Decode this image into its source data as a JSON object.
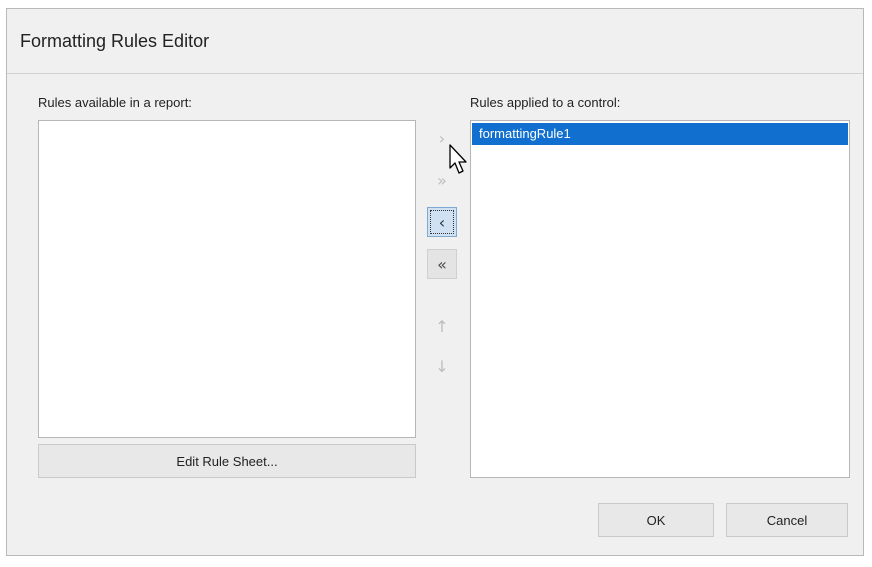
{
  "dialog": {
    "title": "Formatting Rules Editor"
  },
  "available": {
    "label": "Rules available in a report:",
    "items": [],
    "edit_button": "Edit Rule Sheet..."
  },
  "applied": {
    "label": "Rules applied to a control:",
    "items": [
      "formattingRule1"
    ],
    "selected_index": 0
  },
  "transfer_buttons": {
    "move_right": {
      "glyph": "›",
      "icon": "chevron-right-icon",
      "enabled": false
    },
    "move_all_right": {
      "glyph": "»",
      "icon": "double-chevron-right-icon",
      "enabled": false
    },
    "move_left": {
      "glyph": "‹",
      "icon": "chevron-left-icon",
      "enabled": true,
      "focused": true
    },
    "move_all_left": {
      "glyph": "«",
      "icon": "double-chevron-left-icon",
      "enabled": true
    },
    "move_up": {
      "glyph": "↑",
      "icon": "arrow-up-icon",
      "enabled": false
    },
    "move_down": {
      "glyph": "↓",
      "icon": "arrow-down-icon",
      "enabled": false
    }
  },
  "footer": {
    "ok_label": "OK",
    "cancel_label": "Cancel"
  },
  "colors": {
    "selection": "#1170cf",
    "dialog_bg": "#f0f0f0"
  }
}
